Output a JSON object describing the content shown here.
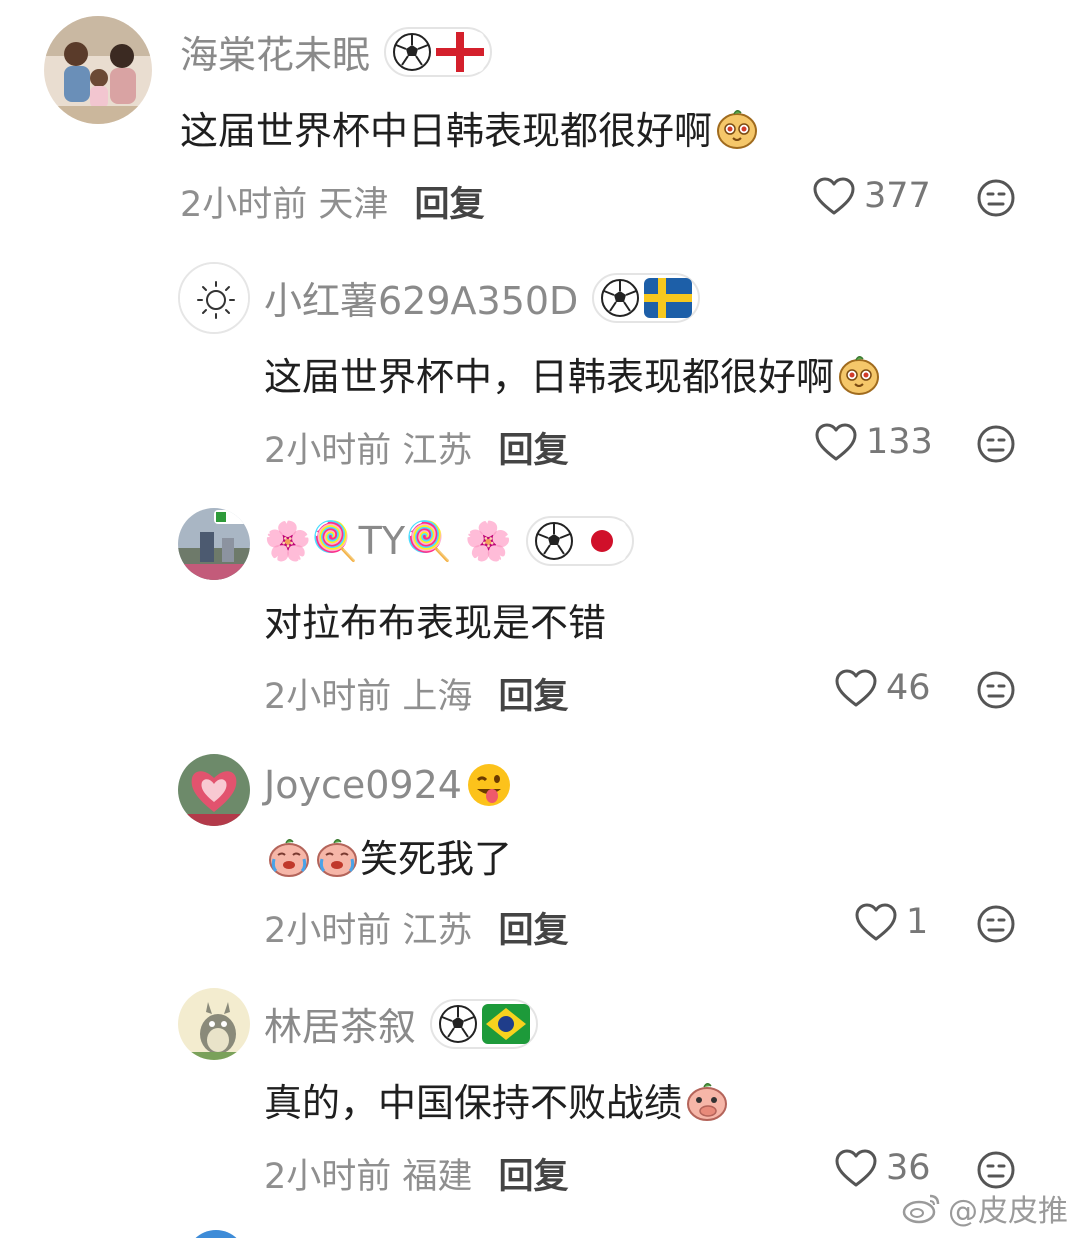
{
  "comments": [
    {
      "username": "海棠花未眠",
      "flag": "england",
      "text": "这届世界杯中日韩表现都很好啊",
      "time": "2小时前",
      "location": "天津",
      "reply": "回复",
      "likes": "377"
    },
    {
      "username": "小红薯629A350D",
      "flag": "sweden",
      "text": "这届世界杯中，日韩表现都很好啊",
      "time": "2小时前",
      "location": "江苏",
      "reply": "回复",
      "likes": "133"
    },
    {
      "username": "🌸🍭TY🍭 🌸",
      "flag": "japan",
      "text": "对拉布布表现是不错",
      "time": "2小时前",
      "location": "上海",
      "reply": "回复",
      "likes": "46"
    },
    {
      "username": "Joyce0924",
      "flag": "",
      "text": "笑死我了",
      "time": "2小时前",
      "location": "江苏",
      "reply": "回复",
      "likes": "1"
    },
    {
      "username": "林居茶叙",
      "flag": "brazil",
      "text": "真的，中国保持不败战绩",
      "time": "2小时前",
      "location": "福建",
      "reply": "回复",
      "likes": "36"
    }
  ],
  "watermark": "@皮皮推",
  "icons": {
    "like": "heart-outline-icon",
    "more": "neutral-face-icon",
    "ball": "soccer-ball-icon"
  },
  "colors": {
    "username": "#8a8a8a",
    "text": "#1f1f1f",
    "meta": "#8f8f8f"
  }
}
